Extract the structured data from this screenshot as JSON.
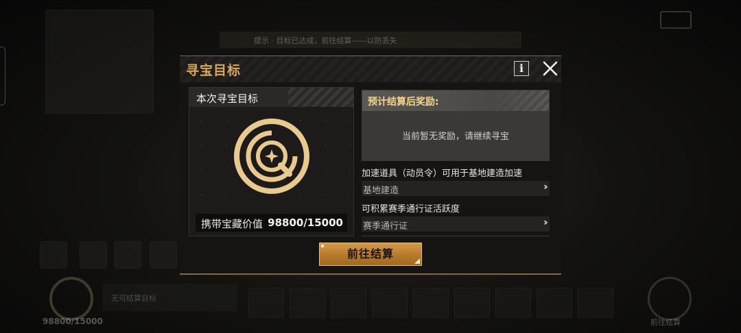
{
  "modal": {
    "title": "寻宝目标",
    "info_label": "i",
    "target_card": {
      "title": "本次寻宝目标",
      "value_label": "携带宝藏价值",
      "value": "98800/15000"
    },
    "reward": {
      "title": "预计结算后奖励:",
      "empty_text": "当前暂无奖励，请继续寻宝"
    },
    "rules": [
      {
        "desc": "加速道具（动员令）可用于基地建造加速",
        "link": "基地建造"
      },
      {
        "desc": "可积累赛季通行证活跃度",
        "link": "赛季通行证"
      }
    ],
    "confirm_button": "前往结算"
  },
  "background": {
    "banner_text": "提示 · 目标已达成，前往结算——以防丢失",
    "bottom_text": "无可结算目标",
    "bottom_left_value": "98800/15000",
    "bottom_right_label": "前往结算"
  },
  "colors": {
    "accent_gold": "#d9a75a",
    "button_gold": "#c88c3a",
    "reward_title": "#f5d58d"
  },
  "icons": [
    "close-icon",
    "info-icon",
    "treasure-radar-icon",
    "double-chevron-right-icon"
  ]
}
